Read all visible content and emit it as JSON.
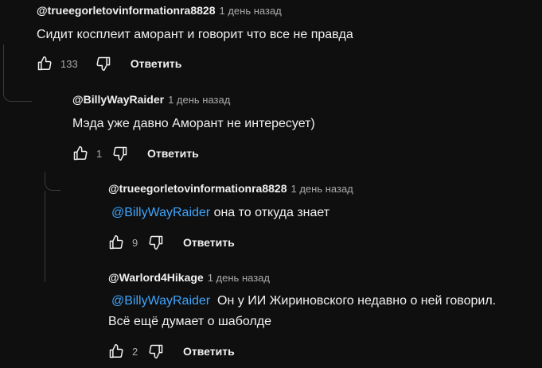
{
  "comments": [
    {
      "author": "@trueegorletovinformationra8828",
      "time": "1 день назад",
      "text": "Сидит косплеит аморант и говорит что все не правда",
      "likes": "133",
      "reply": "Ответить"
    },
    {
      "author": "@BillyWayRaider",
      "time": "1 день назад",
      "text": "Мэда уже давно Аморант не интересует)",
      "likes": "1",
      "reply": "Ответить"
    },
    {
      "author": "@trueegorletovinformationra8828",
      "time": "1 день назад",
      "mention": "@BillyWayRaider",
      "text": " она то откуда знает",
      "likes": "9",
      "reply": "Ответить"
    },
    {
      "author": "@Warlord4Hikage",
      "time": "1 день назад",
      "mention": "@BillyWayRaider",
      "text": "  Он у ИИ Жириновского недавно о ней говорил.",
      "text2": "Всё ещё думает о шаболде",
      "likes": "2",
      "reply": "Ответить"
    }
  ]
}
